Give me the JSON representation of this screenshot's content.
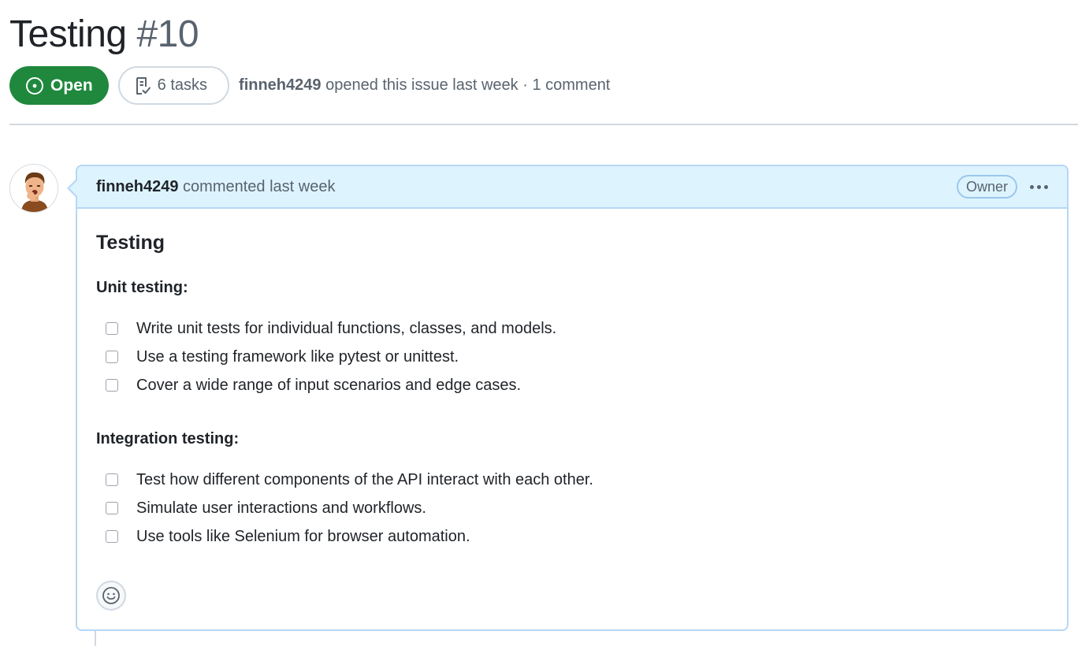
{
  "issue": {
    "title": "Testing",
    "number": "#10",
    "state": "Open",
    "tasks_label": "6 tasks",
    "author": "finneh4249",
    "opened_text": "opened this issue last week · 1 comment"
  },
  "comment": {
    "author": "finneh4249",
    "action": "commented last week",
    "role_badge": "Owner",
    "body": {
      "heading": "Testing",
      "sections": [
        {
          "title": "Unit testing:",
          "tasks": [
            "Write unit tests for individual functions, classes, and models.",
            "Use a testing framework like pytest or unittest.",
            "Cover a wide range of input scenarios and edge cases."
          ]
        },
        {
          "title": "Integration testing:",
          "tasks": [
            "Test how different components of the API interact with each other.",
            "Simulate user interactions and workflows.",
            "Use tools like Selenium for browser automation."
          ]
        }
      ]
    }
  },
  "icons": {
    "state": "issue-open-icon",
    "tasks": "checklist-icon",
    "avatar": "memoji-avatar",
    "more": "kebab-horizontal-icon",
    "reaction": "smiley-icon"
  },
  "colors": {
    "open_green": "#1f883d",
    "comment_header_bg": "#ddf4ff",
    "comment_border": "#b6d7f5",
    "muted_text": "#59636e"
  }
}
